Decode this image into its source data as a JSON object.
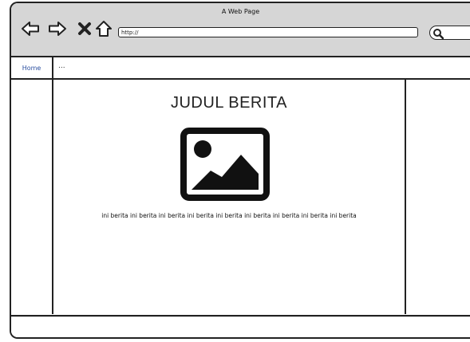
{
  "window": {
    "title": "A Web Page"
  },
  "toolbar": {
    "back_icon": "back-arrow-icon",
    "forward_icon": "forward-arrow-icon",
    "stop_icon": "close-icon",
    "home_icon": "home-icon",
    "url": "http://",
    "search_icon": "search-icon"
  },
  "tabs": {
    "home": "Home",
    "more": "..."
  },
  "content": {
    "headline": "JUDUL BERITA",
    "image_icon": "image-placeholder-icon",
    "body": "ini berita ini berita ini berita ini berita ini berita ini berita ini berita ini berita ini berita"
  }
}
